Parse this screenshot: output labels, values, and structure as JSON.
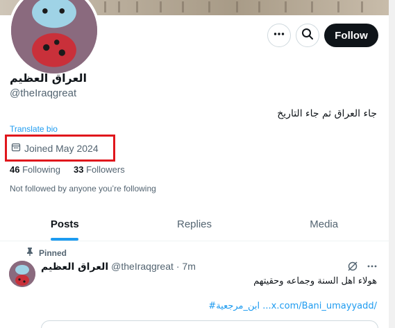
{
  "profile": {
    "display_name": "العراق العظيم",
    "handle": "@theIraqgreat",
    "bio": "جاء العراق ثم جاء التاريخ",
    "translate_label": "Translate bio",
    "joined": "Joined May 2024",
    "following_count": "46",
    "following_label": "Following",
    "followers_count": "33",
    "followers_label": "Followers",
    "not_followed": "Not followed by anyone you’re following"
  },
  "actions": {
    "more_icon": "ellipsis-icon",
    "search_icon": "search-icon",
    "follow_label": "Follow"
  },
  "tabs": [
    {
      "label": "Posts",
      "active": true
    },
    {
      "label": "Replies",
      "active": false
    },
    {
      "label": "Media",
      "active": false
    }
  ],
  "post": {
    "pinned_label": "Pinned",
    "author_name": "العراق العظيم",
    "author_handle": "@theIraqgreat",
    "time": "· 7m",
    "text": "هولاء اهل السنة وجماعه     وحقيتهم",
    "link": "#ابن_مرجعية ...x.com/Bani_umayyadd/"
  },
  "colors": {
    "accent": "#1d9bf0",
    "highlight": "#e0161c",
    "follow_bg": "#0f1419"
  }
}
